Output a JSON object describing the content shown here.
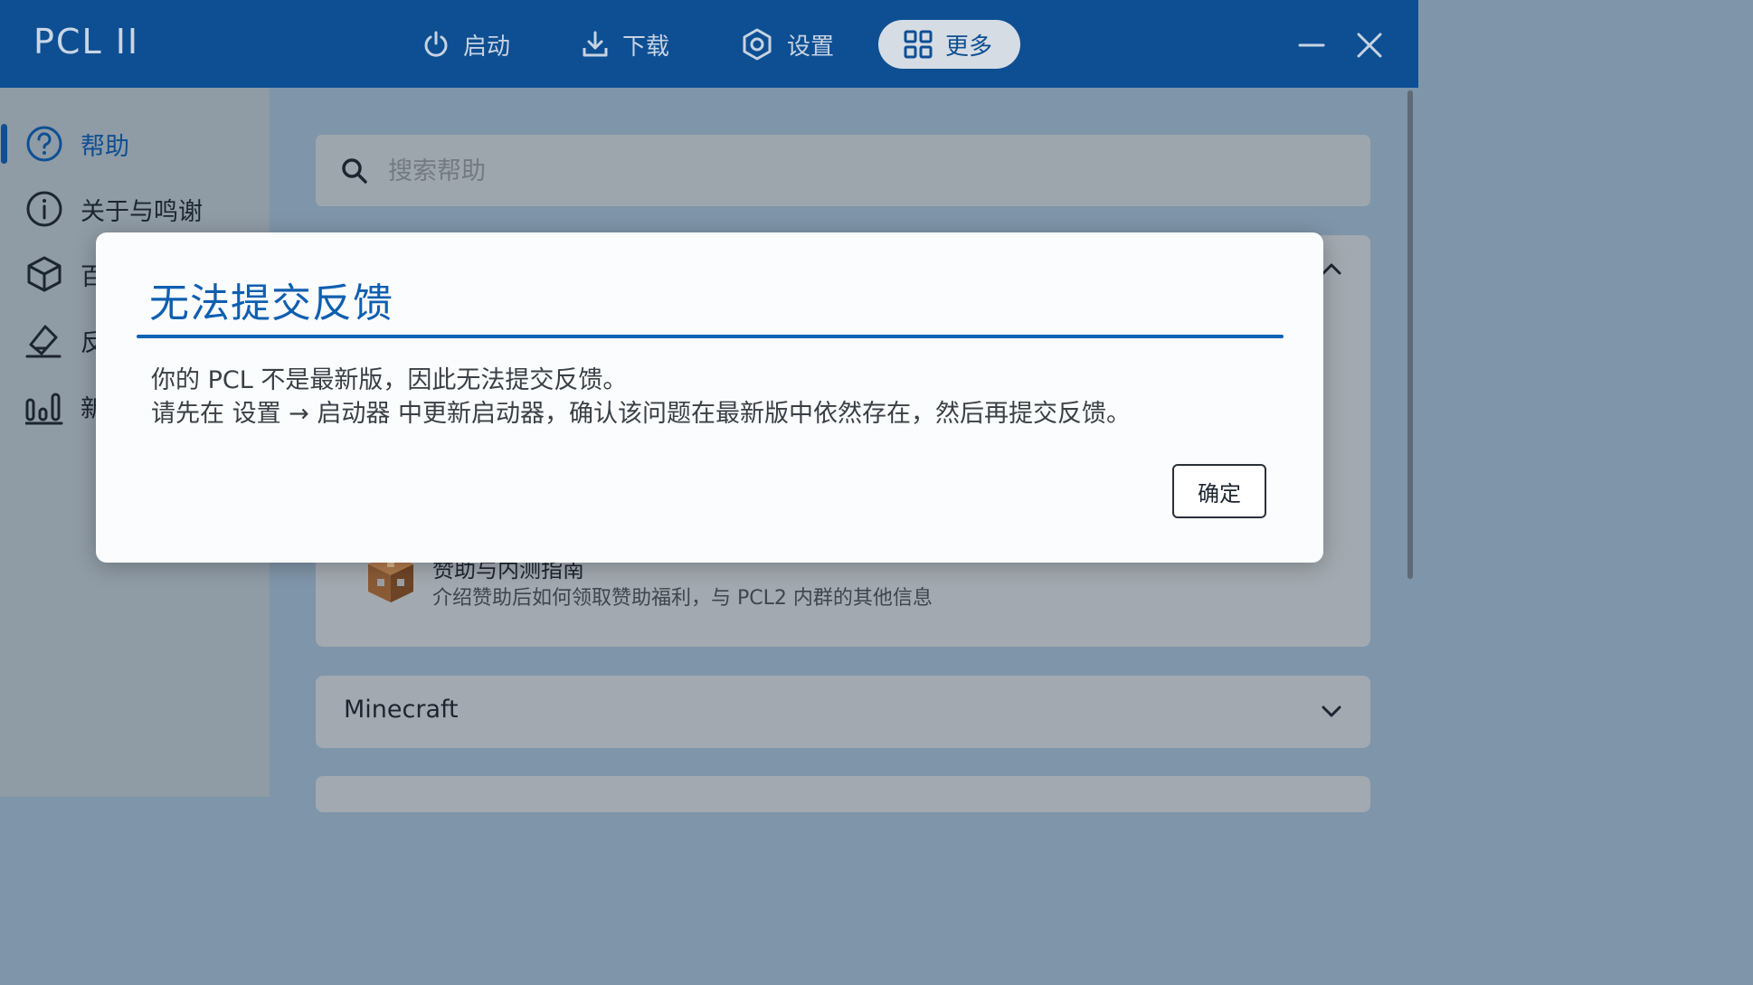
{
  "app": {
    "title": "PCL II"
  },
  "topnav": {
    "items": [
      {
        "label": "启动",
        "icon": "power-icon"
      },
      {
        "label": "下载",
        "icon": "download-icon"
      },
      {
        "label": "设置",
        "icon": "gear-icon"
      },
      {
        "label": "更多",
        "icon": "grid-icon",
        "active": true
      }
    ]
  },
  "sidebar": {
    "items": [
      {
        "label": "帮助",
        "icon": "question-circle-icon",
        "active": true
      },
      {
        "label": "关于与鸣谢",
        "icon": "info-circle-icon"
      },
      {
        "label": "百",
        "icon": "box-icon"
      },
      {
        "label": "反",
        "icon": "feedback-icon"
      },
      {
        "label": "新",
        "icon": "bar-chart-icon"
      }
    ]
  },
  "search": {
    "placeholder": "搜索帮助"
  },
  "help_list": {
    "items": [
      {
        "title": "赞助与内测指南",
        "description": "介绍赞助后如何领取赞助福利，与 PCL2 内群的其他信息"
      }
    ]
  },
  "sections": [
    {
      "title": "Minecraft"
    }
  ],
  "dialog": {
    "title": "无法提交反馈",
    "message_line1": "你的 PCL 不是最新版，因此无法提交反馈。",
    "message_line2": "请先在 设置 → 启动器 中更新启动器，确认该问题在最新版中依然存在，然后再提交反馈。",
    "ok_label": "确定"
  },
  "colors": {
    "accent": "#0E4F93",
    "dialog_title": "#0F5FB0"
  }
}
